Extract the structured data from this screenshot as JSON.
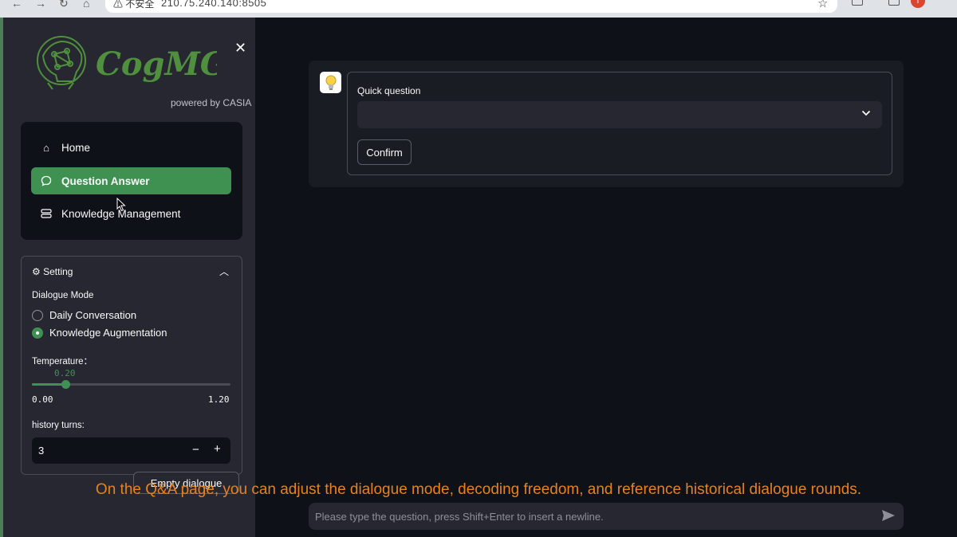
{
  "browser": {
    "security_warning": "⚠ 不安全",
    "url": "210.75.240.140:8505",
    "profile_initial": "T"
  },
  "sidebar": {
    "app_name": "CogMG",
    "powered_by": "powered by CASIA",
    "nav": [
      {
        "label": "Home",
        "icon": "home-icon",
        "active": false
      },
      {
        "label": "Question Answer",
        "icon": "chat-bubble-icon",
        "active": true
      },
      {
        "label": "Knowledge Management",
        "icon": "database-icon",
        "active": false
      }
    ],
    "setting": {
      "title": "⚙ Setting",
      "dialogue_mode_label": "Dialogue Mode",
      "modes": [
        {
          "label": "Daily Conversation",
          "selected": false
        },
        {
          "label": "Knowledge Augmentation",
          "selected": true
        }
      ],
      "temperature_label": "Temperature：",
      "temperature_value": "0.20",
      "temperature_min": "0.00",
      "temperature_max": "1.20",
      "temperature_fraction": 0.1667,
      "history_label": "history turns:",
      "history_value": "3",
      "minus": "−",
      "plus": "+"
    },
    "empty_button": "Empty dialogue"
  },
  "main": {
    "quick_question_label": "Quick question",
    "quick_question_value": "",
    "confirm_label": "Confirm",
    "chat_placeholder": "Please type the question, press Shift+Enter to insert a newline."
  },
  "caption": "On the Q&A page, you can adjust the dialogue mode, decoding freedom, and reference historical dialogue rounds.",
  "colors": {
    "accent": "#3f9152",
    "background": "#0e1117",
    "sidebar": "#262730",
    "caption": "#e8821f"
  }
}
